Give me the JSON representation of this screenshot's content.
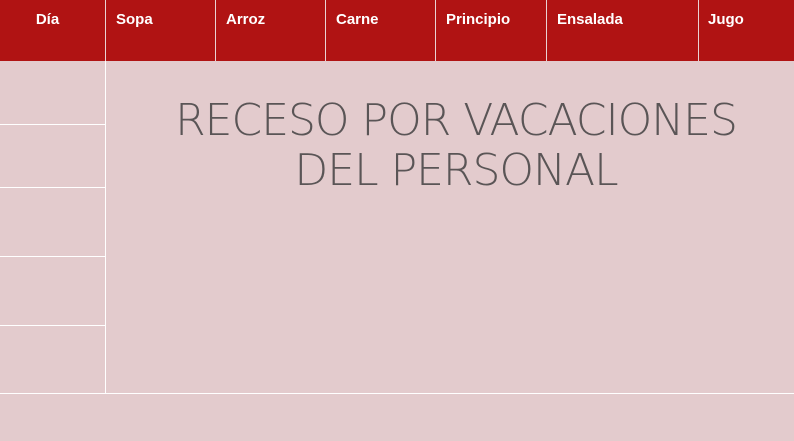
{
  "header": {
    "columns": [
      "Día",
      "Sopa",
      "Arroz",
      "Carne",
      "Principio",
      "Ensalada",
      "Jugo"
    ]
  },
  "notice": {
    "text": "RECESO POR VACACIONES\nDEL PERSONAL"
  },
  "colors": {
    "header_background": "#b01313",
    "body_background": "#e3cbcd",
    "notice_text": "#5a5556"
  }
}
